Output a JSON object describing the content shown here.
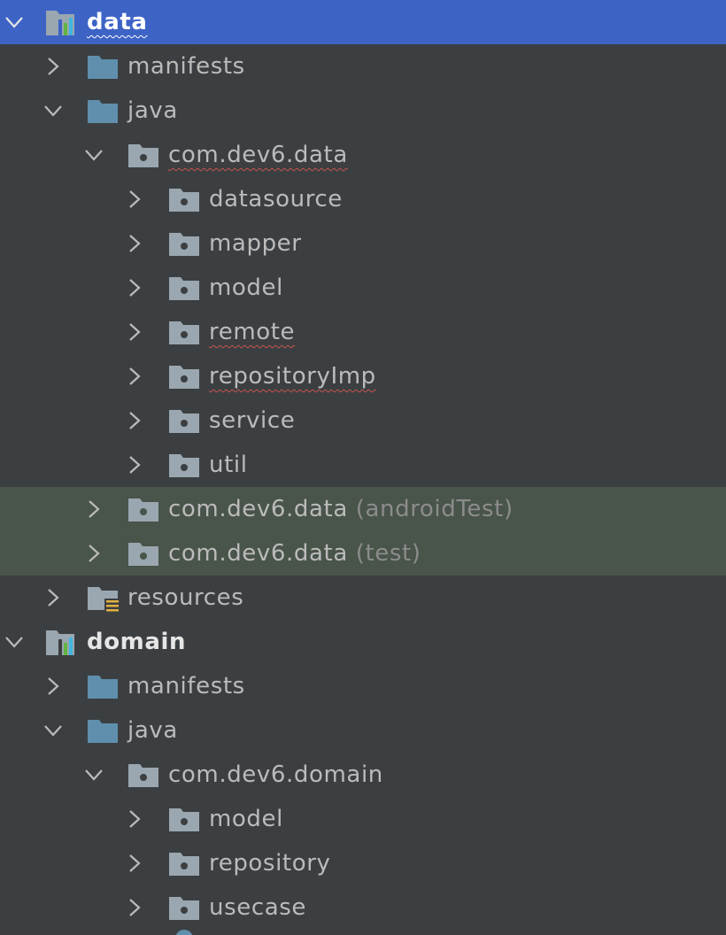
{
  "tree": {
    "data_module": "data",
    "data_manifests": "manifests",
    "data_java": "java",
    "data_pkg": "com.dev6.data",
    "datasource": "datasource",
    "mapper": "mapper",
    "model": "model",
    "remote": "remote",
    "repositoryImp": "repositoryImp",
    "service": "service",
    "util": "util",
    "android_test_pkg": "com.dev6.data",
    "android_test_suffix": "(androidTest)",
    "test_pkg": "com.dev6.data",
    "test_suffix": "(test)",
    "resources": "resources",
    "domain_module": "domain",
    "domain_manifests": "manifests",
    "domain_java": "java",
    "domain_pkg": "com.dev6.domain",
    "domain_model": "model",
    "domain_repository": "repository",
    "domain_usecase": "usecase"
  },
  "colors": {
    "background": "#3c3f41",
    "selection": "#3d63c5",
    "test_highlight": "#49544a",
    "folder_blue": "#5f8fad",
    "package_gray": "#9aa7b0",
    "typo_underline": "#c75450"
  }
}
